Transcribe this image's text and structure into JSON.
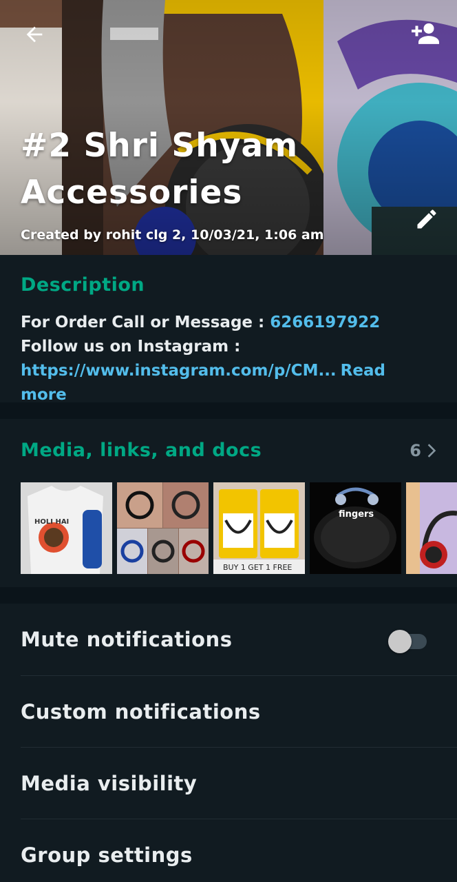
{
  "group": {
    "title": "#2 Shri Shyam Accessories",
    "created": "Created by rohit clg 2, 10/03/21, 1:06 am"
  },
  "description": {
    "heading": "Description",
    "line1_text": "For Order Call or Message : ",
    "line1_phone": "6266197922",
    "line2_text": "Follow us on Instagram :",
    "line3_link": "https://www.instagram.com/p/CM...",
    "read_more": "Read more"
  },
  "media": {
    "heading": "Media, links, and docs",
    "count": "6",
    "thumb_text": {
      "t1": "HOLI HAI",
      "t3": "BUY 1 GET 1 FREE",
      "t4": "fingers"
    }
  },
  "settings": {
    "mute_label": "Mute notifications",
    "mute_on": false,
    "custom_label": "Custom notifications",
    "visibility_label": "Media visibility",
    "group_settings_label": "Group settings"
  },
  "icons": {
    "back": "arrow-left-icon",
    "add_participant": "person-add-icon",
    "edit": "pencil-icon",
    "chevron": "chevron-right-icon"
  },
  "colors": {
    "accent": "#00a884",
    "link": "#53bdeb",
    "background": "#111b21"
  }
}
